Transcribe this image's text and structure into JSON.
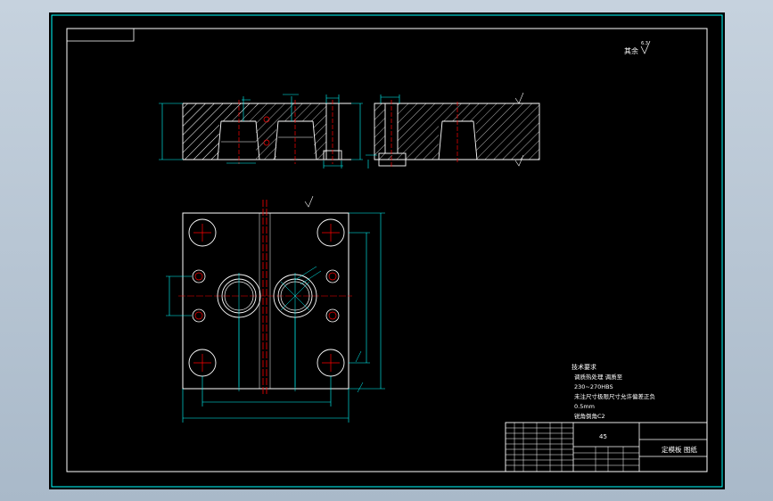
{
  "roughness_note": {
    "label": "其余",
    "value": "6.3"
  },
  "technical_requirements": {
    "title": "技术要求",
    "lines": [
      "调质热处理 调质至",
      "230~270HBS",
      "未注尺寸极限尺寸允许偏差正负",
      "0.5mm",
      "锐角倒角C2"
    ]
  },
  "title_block": {
    "material": "45",
    "part_name": "定模板 图纸"
  },
  "colors": {
    "outline": "#ffffff",
    "dimension": "#00ffff",
    "centerline": "#ff0000",
    "border": "#00ffff",
    "hatch": "#ffffff"
  }
}
